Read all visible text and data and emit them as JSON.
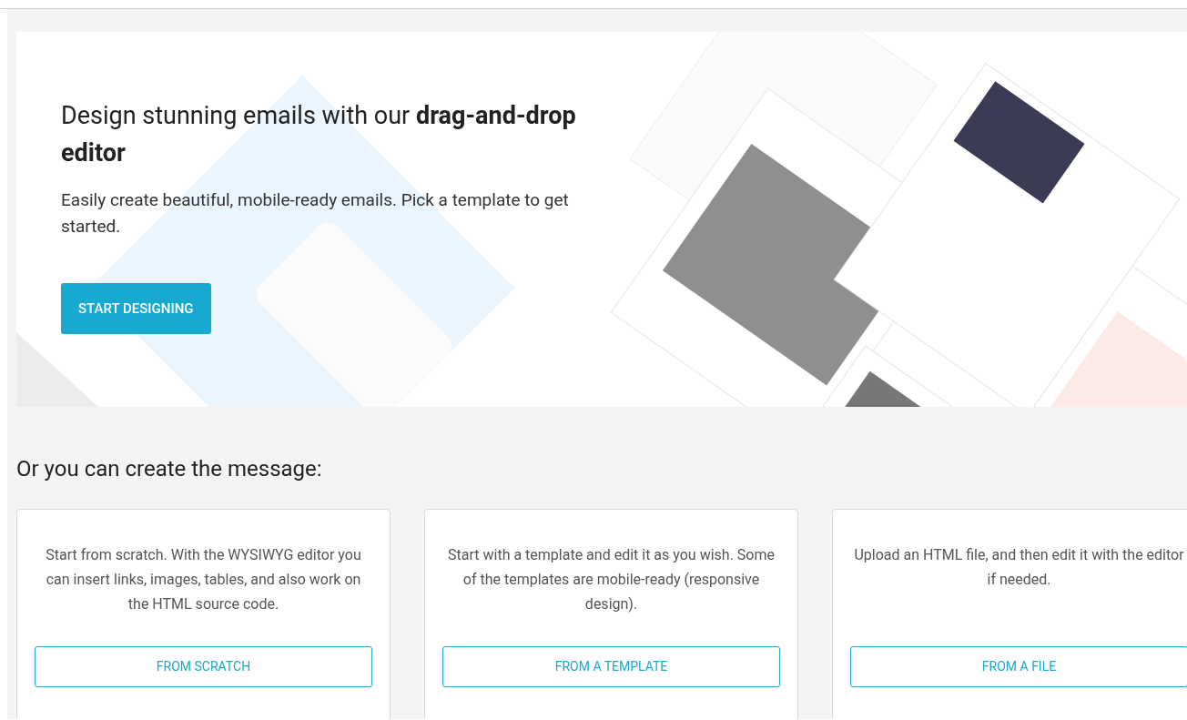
{
  "hero": {
    "heading": "Design stunning emails with our **drag-and-drop editor**",
    "text": "Easily create beautiful, mobile-ready emails. Pick a template to get started.",
    "button": "START DESIGNING"
  },
  "section_title": "Or you can create the message:",
  "options": [
    {
      "description": "Start from scratch. With the WYSIWYG editor you can insert links, images, tables, and also work on the HTML source code.",
      "button": "FROM SCRATCH"
    },
    {
      "description": "Start with a template and edit it as you wish. Some of the templates are mobile-ready (responsive design).",
      "button": "FROM A TEMPLATE"
    },
    {
      "description": "Upload an HTML file, and then edit it with the editor if needed.",
      "button": "FROM A FILE"
    }
  ]
}
